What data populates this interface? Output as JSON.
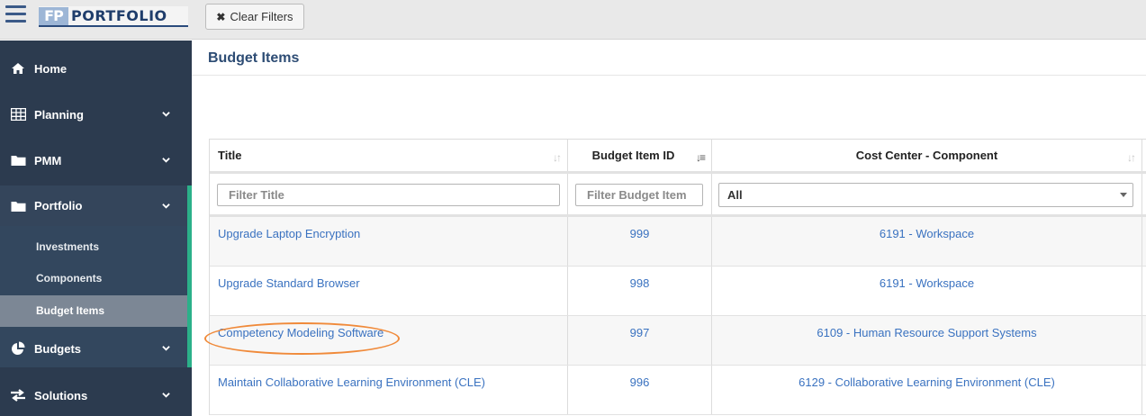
{
  "app": {
    "logo_initials": "FP",
    "logo_word": "PORTFOLIO",
    "clear_filters_label": "Clear Filters"
  },
  "sidebar": {
    "items": [
      {
        "label": "Home",
        "icon": "home-icon"
      },
      {
        "label": "Planning",
        "icon": "table-icon"
      },
      {
        "label": "PMM",
        "icon": "folder-icon"
      },
      {
        "label": "Portfolio",
        "icon": "folder-icon"
      },
      {
        "label": "Budgets",
        "icon": "pie-chart-icon"
      },
      {
        "label": "Solutions",
        "icon": "exchange-icon"
      }
    ],
    "sub_items": [
      "Investments",
      "Components",
      "Budget Items"
    ],
    "selected_sub_item": "Budget Items",
    "accent_color": "#2bb089"
  },
  "page": {
    "title": "Budget Items"
  },
  "table": {
    "columns": [
      "Title",
      "Budget Item ID",
      "Cost Center - Component"
    ],
    "filters": {
      "title_placeholder": "Filter Title",
      "id_placeholder": "Filter Budget Item",
      "cost_center_value": "All"
    },
    "rows": [
      {
        "title": "Upgrade Laptop Encryption",
        "id": "999",
        "cost_center": "6191 - Workspace"
      },
      {
        "title": "Upgrade Standard Browser",
        "id": "998",
        "cost_center": "6191 - Workspace"
      },
      {
        "title": "Competency Modeling Software",
        "id": "997",
        "cost_center": "6109 - Human Resource Support Systems"
      },
      {
        "title": "Maintain Collaborative Learning Environment (CLE)",
        "id": "996",
        "cost_center": "6129 - Collaborative Learning Environment (CLE)"
      }
    ],
    "highlight_color": "#f08a3a",
    "link_color": "#3a72c0"
  }
}
